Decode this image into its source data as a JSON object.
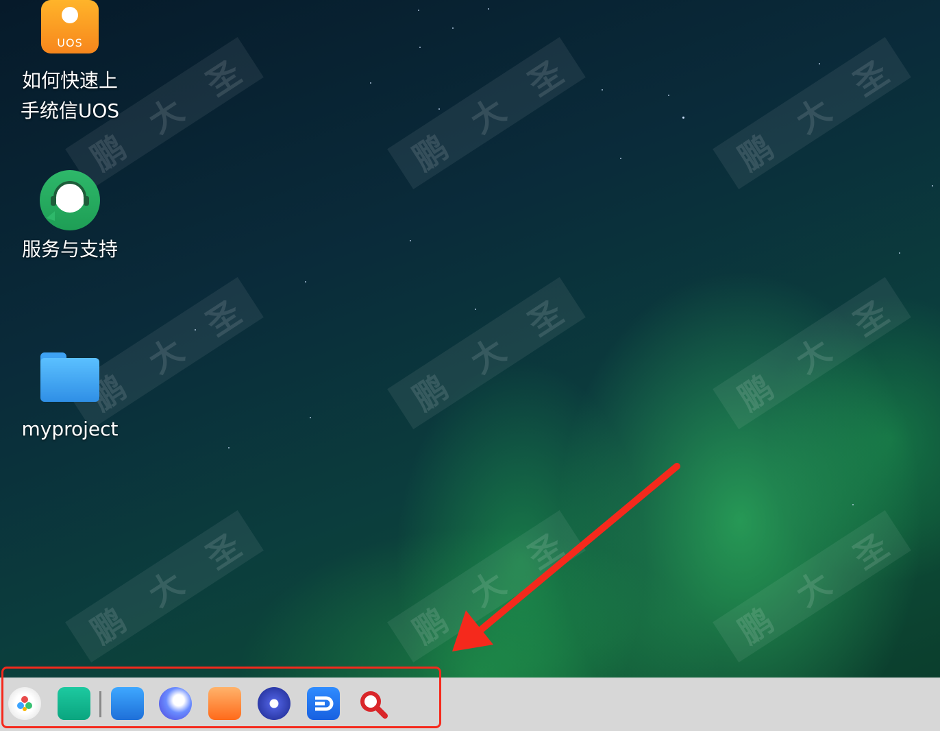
{
  "desktop": {
    "icons": [
      {
        "label": "如何快速上\n手统信UOS",
        "icon": "uos-guide-icon",
        "tile_text": "UOS"
      },
      {
        "label": "服务与支持",
        "icon": "customer-service-icon"
      },
      {
        "label": "myproject",
        "icon": "folder-icon"
      }
    ]
  },
  "watermark": {
    "chars": [
      "鹏",
      "大",
      "圣"
    ]
  },
  "dock": {
    "items": [
      {
        "icon": "launcher-icon"
      },
      {
        "icon": "multitask-view-icon"
      },
      {
        "icon": "file-manager-icon"
      },
      {
        "icon": "browser-icon"
      },
      {
        "icon": "app-store-icon"
      },
      {
        "icon": "control-center-icon"
      },
      {
        "icon": "dingtalk-like-icon"
      },
      {
        "icon": "search-icon"
      }
    ]
  },
  "annotation": {
    "color": "#f5291c",
    "type": "red box with arrow pointing to dock"
  }
}
